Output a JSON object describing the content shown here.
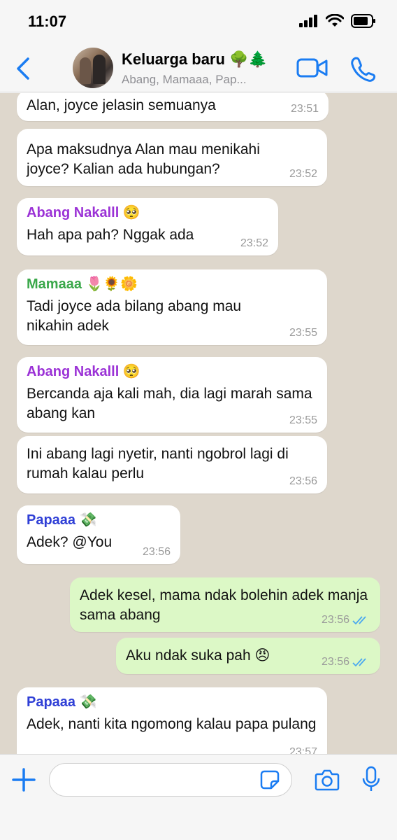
{
  "status_bar": {
    "time": "11:07"
  },
  "header": {
    "title": "Keluarga baru 🌳🌲",
    "subtitle": "Abang, Mamaaa, Pap..."
  },
  "colors": {
    "accent": "#1a7cf2",
    "sender_abang": "#9b32d6",
    "sender_mamaaa": "#3aa84a",
    "sender_papaaa": "#2f3fd6",
    "outgoing_bubble": "#dcf8c6",
    "read_tick": "#4aa8f0"
  },
  "messages": [
    {
      "text": "Alan, joyce jelasin semuanya",
      "time": "23:51"
    },
    {
      "text": "Apa maksudnya Alan mau menikahi joyce? Kalian ada hubungan?",
      "time": "23:52"
    },
    {
      "sender": "Abang Nakalll 🥺",
      "text": "Hah apa pah? Nggak ada",
      "time": "23:52"
    },
    {
      "sender": "Mamaaa 🌷🌻🌼",
      "text": "Tadi joyce ada bilang abang mau nikahin adek",
      "time": "23:55"
    },
    {
      "sender": "Abang Nakalll 🥺",
      "text": "Bercanda aja kali mah, dia lagi marah sama abang kan",
      "time": "23:55"
    },
    {
      "text": "Ini abang lagi nyetir, nanti ngobrol lagi di rumah kalau perlu",
      "time": "23:56"
    },
    {
      "sender": "Papaaa 💸",
      "text": "Adek? @You",
      "time": "23:56"
    },
    {
      "text": "Adek kesel, mama ndak bolehin adek manja sama abang",
      "time": "23:56"
    },
    {
      "text": "Aku ndak suka pah 😠",
      "time": "23:56"
    },
    {
      "sender": "Papaaa 💸",
      "text": "Adek, nanti kita ngomong kalau papa pulang",
      "time": "23:57"
    }
  ],
  "composer": {
    "placeholder": ""
  }
}
